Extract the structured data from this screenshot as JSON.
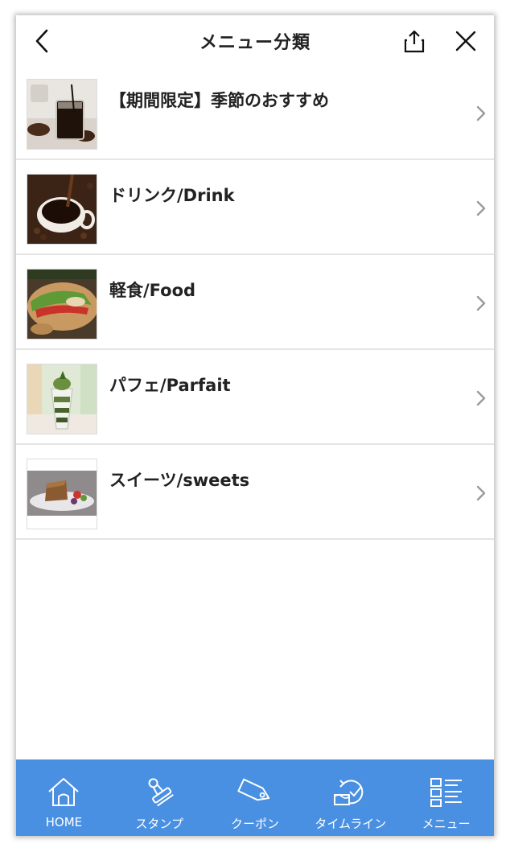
{
  "header": {
    "title": "メニュー分類"
  },
  "menu": [
    {
      "label": "【期間限定】季節のおすすめ",
      "image": "iced-coffee-photo"
    },
    {
      "label": "ドリンク/Drink",
      "image": "hot-coffee-photo"
    },
    {
      "label": "軽食/Food",
      "image": "sandwich-photo"
    },
    {
      "label": "パフェ/Parfait",
      "image": "parfait-photo"
    },
    {
      "label": "スイーツ/sweets",
      "image": "cake-photo"
    }
  ],
  "tabs": [
    {
      "label": "HOME",
      "icon": "home-icon"
    },
    {
      "label": "スタンプ",
      "icon": "stamp-icon"
    },
    {
      "label": "クーポン",
      "icon": "coupon-icon"
    },
    {
      "label": "タイムライン",
      "icon": "timeline-icon"
    },
    {
      "label": "メニュー",
      "icon": "menu-list-icon"
    }
  ],
  "colors": {
    "tabbar": "#4a90e2",
    "text": "#222222",
    "chevron": "#9b9b9b"
  }
}
